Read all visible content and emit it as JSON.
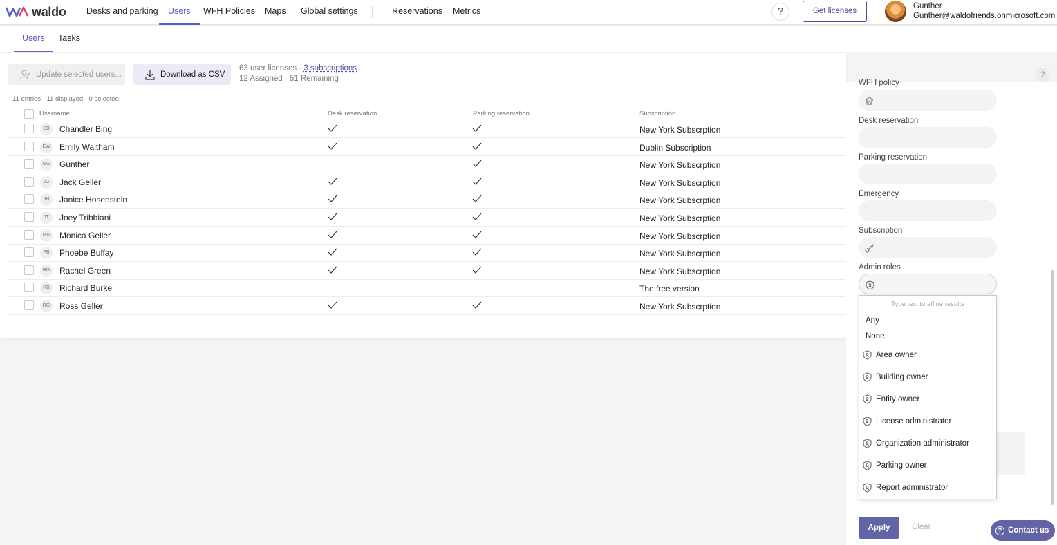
{
  "app": {
    "logo_text": "waldo",
    "brand_color": "#5b5fc7",
    "nav": [
      {
        "label": "Desks and parking"
      },
      {
        "label": "Users"
      },
      {
        "label": "WFH Policies"
      },
      {
        "label": "Maps"
      },
      {
        "label": "Global settings"
      },
      {
        "label": "Reservations"
      },
      {
        "label": "Metrics"
      }
    ],
    "active_nav": "Users",
    "help_label": "?",
    "get_licenses_label": "Get licenses",
    "user": {
      "name": "Gunther",
      "email": "Gunther@waldofriends.onmicrosoft.com"
    }
  },
  "subtabs": [
    {
      "label": "Users"
    },
    {
      "label": "Tasks"
    }
  ],
  "toolbar": {
    "update_label": "Update selected users...",
    "csv_label": "Download as CSV",
    "licenses_text": "63 user licenses · ",
    "subscriptions_link": "3 subscriptions",
    "assigned_text": "12 Assigned · 51 Remaining"
  },
  "entries_text": "11 entries · 11 displayed · 0 selected",
  "table": {
    "headers": {
      "username": "Username",
      "desk": "Desk reservation",
      "parking": "Parking reservation",
      "subscription": "Subscription"
    },
    "rows": [
      {
        "initials": "CB",
        "name": "Chandler Bing",
        "desk": true,
        "parking": true,
        "subscription": "New York Subscrption"
      },
      {
        "initials": "EW",
        "name": "Emily Waltham",
        "desk": true,
        "parking": true,
        "subscription": "Dublin Subscription"
      },
      {
        "initials": "GG",
        "name": "Gunther",
        "desk": false,
        "parking": true,
        "subscription": "New York Subscrption"
      },
      {
        "initials": "JG",
        "name": "Jack Geller",
        "desk": true,
        "parking": true,
        "subscription": "New York Subscrption"
      },
      {
        "initials": "JH",
        "name": "Janice Hosenstein",
        "desk": true,
        "parking": true,
        "subscription": "New York Subscrption"
      },
      {
        "initials": "JT",
        "name": "Joey Tribbiani",
        "desk": true,
        "parking": true,
        "subscription": "New York Subscrption"
      },
      {
        "initials": "MG",
        "name": "Monica Geller",
        "desk": true,
        "parking": true,
        "subscription": "New York Subscrption"
      },
      {
        "initials": "PB",
        "name": "Phoebe Buffay",
        "desk": true,
        "parking": true,
        "subscription": "New York Subscrption"
      },
      {
        "initials": "RG",
        "name": "Rachel Green",
        "desk": true,
        "parking": true,
        "subscription": "New York Subscrption"
      },
      {
        "initials": "RB",
        "name": "Richard Burke",
        "desk": false,
        "parking": false,
        "subscription": "The free version"
      },
      {
        "initials": "RG",
        "name": "Ross Geller",
        "desk": true,
        "parking": true,
        "subscription": "New York Subscrption"
      }
    ]
  },
  "filters": {
    "wfh_label": "WFH policy",
    "desk_label": "Desk reservation",
    "parking_label": "Parking reservation",
    "emergency_label": "Emergency",
    "subscription_label": "Subscription",
    "admin_roles_label": "Admin roles",
    "dropdown": {
      "placeholder": "Type text to affine results",
      "options": [
        "Any",
        "None"
      ],
      "roles": [
        "Area owner",
        "Building owner",
        "Entity owner",
        "License administrator",
        "Organization administrator",
        "Parking owner",
        "Report administrator"
      ]
    },
    "apply_label": "Apply",
    "clear_label": "Clear"
  },
  "contact_label": "Contact us"
}
